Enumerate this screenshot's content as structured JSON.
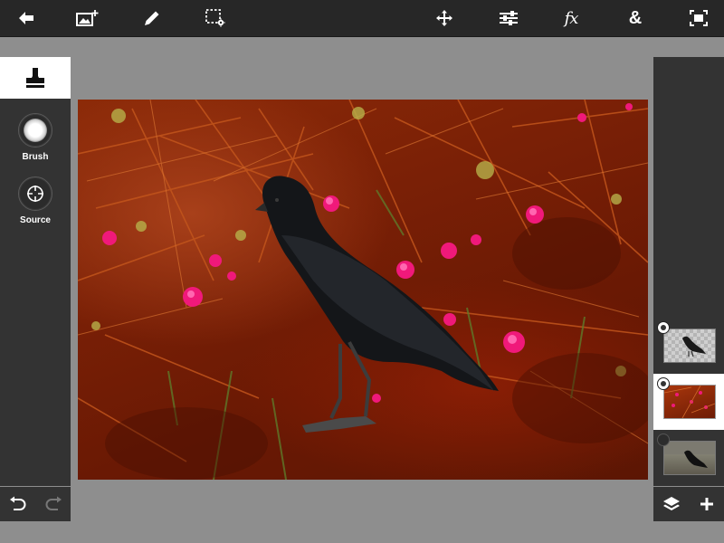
{
  "toolbar": {
    "items": [
      {
        "name": "back-icon"
      },
      {
        "name": "add-image-icon"
      },
      {
        "name": "pencil-icon"
      },
      {
        "name": "selection-settings-icon"
      },
      {
        "name": "move-icon"
      },
      {
        "name": "adjustments-icon"
      },
      {
        "name": "fx-icon",
        "label": "fx"
      },
      {
        "name": "blend-icon",
        "label": "&"
      },
      {
        "name": "fit-screen-icon"
      }
    ]
  },
  "left_panel": {
    "active_tool": "clone-stamp-icon",
    "options": [
      {
        "name": "brush-icon",
        "label": "Brush"
      },
      {
        "name": "source-icon",
        "label": "Source"
      }
    ],
    "undo_icon": "undo-icon",
    "redo_icon": "redo-icon",
    "redo_enabled": false
  },
  "canvas": {
    "content": "photo-crow-in-red-field"
  },
  "layers": {
    "items": [
      {
        "name": "layer-crow",
        "thumb": "crow-cutout-transparent",
        "visible": true,
        "selected": false
      },
      {
        "name": "layer-field",
        "thumb": "red-field",
        "visible": true,
        "selected": true
      },
      {
        "name": "layer-original",
        "thumb": "crow-original",
        "visible": false,
        "selected": false
      }
    ],
    "bar_icons": [
      "layers-icon",
      "add-layer-icon"
    ]
  },
  "colors": {
    "toolbar_bg": "#272727",
    "panel_bg": "#333333",
    "workspace_bg": "#8e8e8e",
    "selected_bg": "#ffffff",
    "icon": "#ffffff"
  }
}
